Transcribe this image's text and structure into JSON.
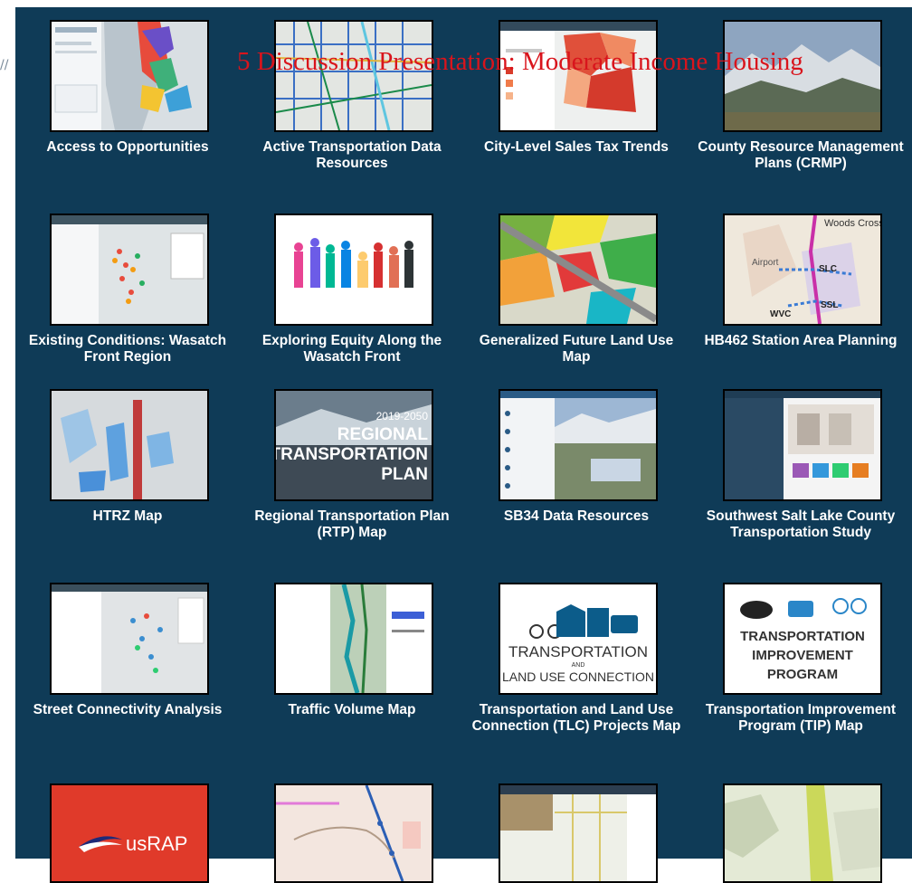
{
  "overlay_title": "5 Discussion Presentation: Moderate Income Housing",
  "stray_text": "//",
  "cards": [
    {
      "label": "Access to Opportunities"
    },
    {
      "label": "Active Transportation Data Resources"
    },
    {
      "label": "City-Level Sales Tax Trends"
    },
    {
      "label": "County Resource Management Plans (CRMP)"
    },
    {
      "label": "Existing Conditions: Wasatch Front Region"
    },
    {
      "label": "Exploring Equity Along the Wasatch Front"
    },
    {
      "label": "Generalized Future Land Use Map"
    },
    {
      "label": "HB462 Station Area Planning"
    },
    {
      "label": "HTRZ Map"
    },
    {
      "label": "Regional Transportation Plan (RTP) Map"
    },
    {
      "label": "SB34 Data Resources"
    },
    {
      "label": "Southwest Salt Lake County Transportation Study"
    },
    {
      "label": "Street Connectivity Analysis"
    },
    {
      "label": "Traffic Volume Map"
    },
    {
      "label": "Transportation and Land Use Connection (TLC) Projects Map"
    },
    {
      "label": "Transportation Improvement Program (TIP) Map"
    },
    {
      "label": ""
    },
    {
      "label": ""
    },
    {
      "label": ""
    },
    {
      "label": ""
    }
  ],
  "thumb_text": {
    "hb462_woods_cross": "Woods Cross",
    "hb462_airport": "Airport",
    "hb462_slc": "SLC",
    "hb462_ssl": "SSL",
    "hb462_wvc": "WVC",
    "rtp_years": "2019-2050",
    "rtp_line1": "REGIONAL",
    "rtp_line2": "TRANSPORTATION",
    "rtp_line3": "PLAN",
    "tlc_line1": "TRANSPORTATION",
    "tlc_line2": "AND",
    "tlc_line3": "LAND USE CONNECTION",
    "tip_line1": "TRANSPORTATION",
    "tip_line2": "IMPROVEMENT",
    "tip_line3": "PROGRAM",
    "usrap_logo": "usRAP"
  },
  "colors": {
    "panel_bg": "#0f3b57",
    "overlay_title": "#d9141c",
    "label": "#ffffff",
    "usrap_bg": "#e03a2a"
  }
}
